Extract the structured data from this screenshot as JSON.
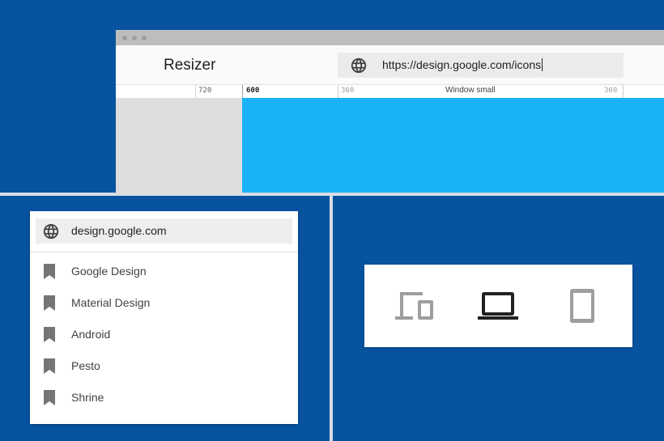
{
  "window": {
    "app_title": "Resizer",
    "url": "https://design.google.com/icons",
    "ruler": {
      "mark_720": "720",
      "mark_600": "600",
      "mark_360_left": "360",
      "label": "Window small",
      "mark_360_right": "360"
    }
  },
  "bookmarks": {
    "header_url": "design.google.com",
    "items": [
      {
        "label": "Google Design"
      },
      {
        "label": "Material Design"
      },
      {
        "label": "Android"
      },
      {
        "label": "Pesto"
      },
      {
        "label": "Shrine"
      }
    ]
  },
  "devices": [
    {
      "icon": "devices-icon",
      "state": "inactive"
    },
    {
      "icon": "laptop-icon",
      "state": "selected"
    },
    {
      "icon": "tablet-icon",
      "state": "inactive"
    }
  ],
  "colors": {
    "background": "#0753a0",
    "viewport_accent": "#1ab2f6",
    "selected_icon": "#212121",
    "inactive_icon": "#9e9e9e"
  }
}
